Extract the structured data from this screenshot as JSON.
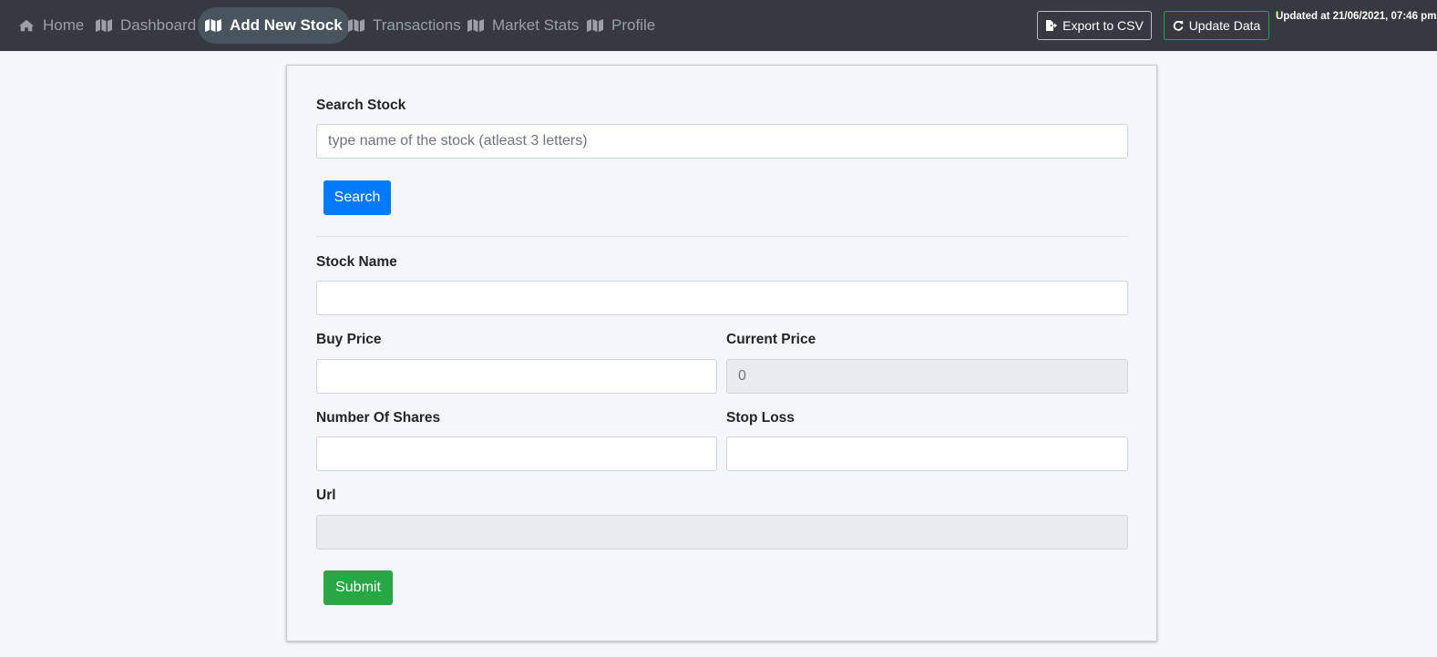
{
  "nav": {
    "items": [
      {
        "label": "Home",
        "icon": "home-icon"
      },
      {
        "label": "Dashboard",
        "icon": "map-icon"
      },
      {
        "label": "Add New Stock",
        "icon": "map-icon",
        "active": true
      },
      {
        "label": "Transactions",
        "icon": "map-icon"
      },
      {
        "label": "Market Stats",
        "icon": "map-icon"
      },
      {
        "label": "Profile",
        "icon": "map-icon"
      }
    ],
    "export_label": "Export to CSV",
    "update_label": "Update Data",
    "updated_text": "Updated at 21/06/2021, 07:46 pm"
  },
  "form": {
    "search_label": "Search Stock",
    "search_placeholder": "type name of the stock (atleast 3 letters)",
    "search_value": "",
    "search_button": "Search",
    "stock_name_label": "Stock Name",
    "stock_name_value": "",
    "buy_price_label": "Buy Price",
    "buy_price_value": "",
    "current_price_label": "Current Price",
    "current_price_value": "0",
    "shares_label": "Number Of Shares",
    "shares_value": "",
    "stop_loss_label": "Stop Loss",
    "stop_loss_value": "",
    "url_label": "Url",
    "url_value": "",
    "submit_button": "Submit"
  },
  "colors": {
    "navbar": "#343a40",
    "active_pill": "#48545e",
    "primary": "#007bff",
    "success": "#28a745",
    "background": "#f4f7fa"
  }
}
